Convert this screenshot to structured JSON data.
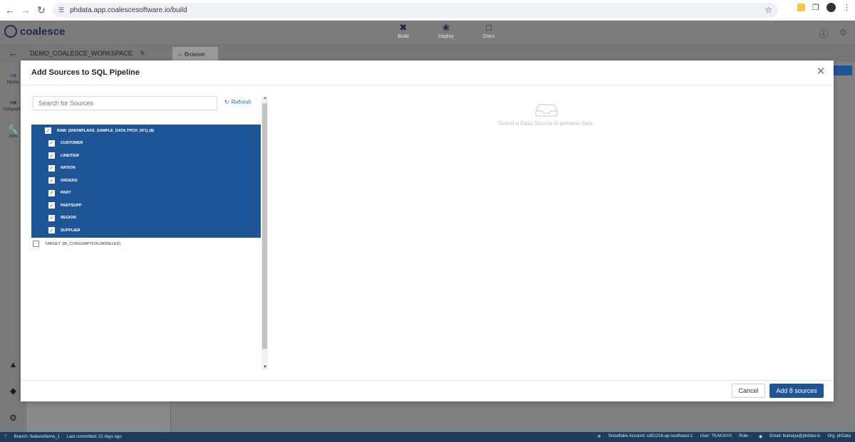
{
  "browser": {
    "url": "phdata.app.coalescesoftware.io/build"
  },
  "app": {
    "logo_text": "coalesce",
    "nav": [
      {
        "label": "Build",
        "icon": "build-icon",
        "active": true
      },
      {
        "label": "Deploy",
        "icon": "deploy-icon",
        "active": false
      },
      {
        "label": "Docs",
        "icon": "docs-icon",
        "active": false
      }
    ],
    "workspace_name": "DEMO_COALESCE_WORKSPACE",
    "browser_tab_label": "Browser",
    "rail": [
      {
        "label": "Nodes",
        "icon": "nodes-icon"
      },
      {
        "label": "Subgraphs",
        "icon": "subgraphs-icon"
      },
      {
        "label": "Jobs",
        "icon": "jobs-icon"
      }
    ]
  },
  "modal": {
    "title": "Add Sources to SQL Pipeline",
    "search_placeholder": "Search for Sources",
    "refresh_label": "Refresh",
    "tree": {
      "selected_group": {
        "label": "RAW. (SNOWFLAKE_SAMPLE_DATA.TPCH_SF1) (8)",
        "checked": true,
        "children": [
          {
            "label": "CUSTOMER",
            "checked": true
          },
          {
            "label": "LINEITEM",
            "checked": true
          },
          {
            "label": "NATION",
            "checked": true
          },
          {
            "label": "ORDERS",
            "checked": true
          },
          {
            "label": "PART",
            "checked": true
          },
          {
            "label": "PARTSUPP",
            "checked": true
          },
          {
            "label": "REGION",
            "checked": true
          },
          {
            "label": "SUPPLIER",
            "checked": true
          }
        ]
      },
      "other_group": {
        "label": "TARGET. (BI_CONSUMPTION.MODELED)",
        "checked": false
      }
    },
    "preview_message": "Select a Data Source to preview data.",
    "cancel_label": "Cancel",
    "add_label": "Add 8 sources"
  },
  "statusbar": {
    "branch": "Branch: feature/demo_1",
    "last_committed": "Last committed: 22 days ago",
    "snowflake_account": "Snowflake Account: vd51216.ap-southeast-1",
    "user": "User: TKAKAIYA",
    "role": "Role: -",
    "email": "Email: tkakaiya@phdata.io",
    "org": "Org: phData"
  }
}
